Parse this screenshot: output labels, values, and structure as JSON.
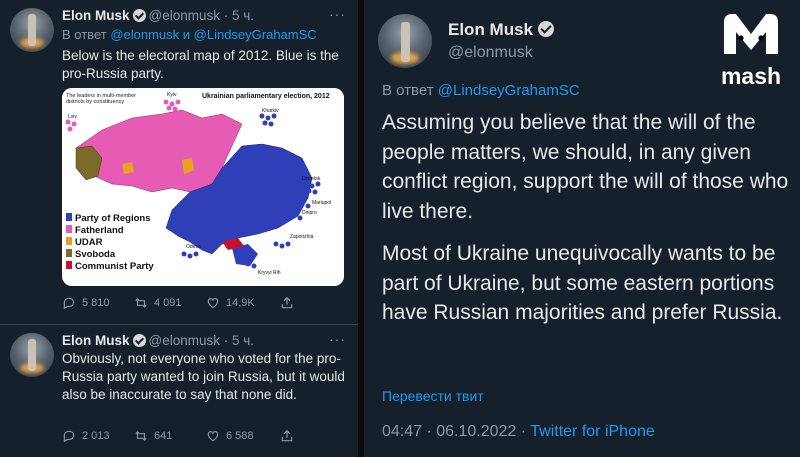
{
  "left_panel": {
    "tweets": [
      {
        "name": "Elon Musk",
        "handle": "@elonmusk",
        "time": "· 5 ч.",
        "reply_prefix": "В ответ",
        "reply_handles": "@elonmusk и @LindseyGrahamSC",
        "text": "Below is the electoral map of 2012. Blue is the pro-Russia party.",
        "map": {
          "title": "Ukrainian parliamentary election, 2012",
          "subtitle": "The leaders in multi-member districts by constituency",
          "cities": [
            "Kyiv",
            "Lviv",
            "Kharkiv",
            "Donetsk",
            "Mariupol",
            "Dnipro",
            "Zaporizhia",
            "Odesa",
            "Kryvyi Rih"
          ],
          "legend": [
            {
              "label": "Party of Regions",
              "color": "#2f3fb8"
            },
            {
              "label": "Fatherland",
              "color": "#e65cb5"
            },
            {
              "label": "UDAR",
              "color": "#e8a21f"
            },
            {
              "label": "Svoboda",
              "color": "#7b6a2a"
            },
            {
              "label": "Communist Party",
              "color": "#c8102e"
            }
          ]
        },
        "replies": "5 810",
        "retweets": "4 091",
        "likes": "14,9K"
      },
      {
        "name": "Elon Musk",
        "handle": "@elonmusk",
        "time": "· 5 ч.",
        "text": "Obviously, not everyone who voted for the pro-Russia party wanted to join Russia, but it would also be inaccurate to say that none did.",
        "replies": "2 013",
        "retweets": "641",
        "likes": "6 588"
      }
    ]
  },
  "right_panel": {
    "name": "Elon Musk",
    "handle": "@elonmusk",
    "brand_logo": "mash",
    "reply_prefix": "В ответ",
    "reply_handle": "@LindseyGrahamSC",
    "paragraph1": "Assuming you believe that the will of the people matters, we should, in any given conflict region, support the will of those who live there.",
    "paragraph2": "Most of Ukraine unequivocally wants to be part of Ukraine, but some eastern portions have Russian majorities and prefer Russia.",
    "translate": "Перевести твит",
    "timestamp": "04:47 · 06.10.2022 ·",
    "client": "Twitter for iPhone"
  },
  "colors": {
    "background": "#15202b",
    "accent": "#1d9bf0",
    "muted": "#8b98a5"
  }
}
